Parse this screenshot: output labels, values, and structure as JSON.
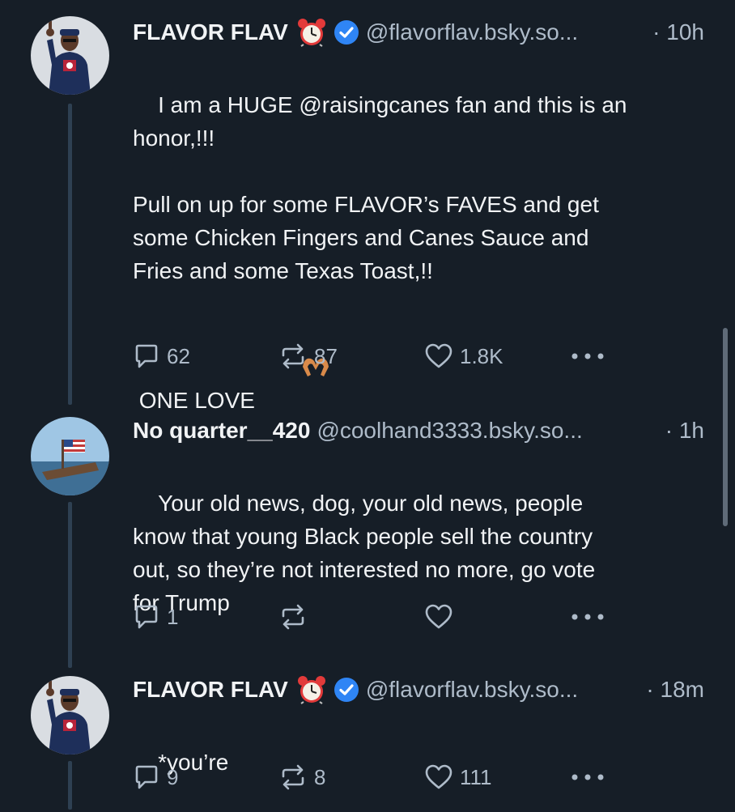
{
  "posts": [
    {
      "display_name": "FLAVOR FLAV",
      "handle": "@flavorflav.bsky.so...",
      "time": "· 10h",
      "text": "I am a HUGE @raisingcanes fan and this is an\nhonor,!!!\n\nPull on up for some FLAVOR’s FAVES and get\nsome Chicken Fingers and Canes Sauce and\nFries and some Texas Toast,!!\n\n ONE LOVE",
      "replies": "62",
      "reposts": "87",
      "likes": "1.8K"
    },
    {
      "display_name": "No quarter__420",
      "handle": "@coolhand3333.bsky.so...",
      "time": "· 1h",
      "text": "Your old news, dog, your old news, people\nknow that young Black people sell the country\nout, so they’re not interested no more, go vote\nfor Trump",
      "replies": "1",
      "reposts": "",
      "likes": ""
    },
    {
      "display_name": "FLAVOR FLAV",
      "handle": "@flavorflav.bsky.so...",
      "time": "· 18m",
      "text": "*you’re",
      "replies": "9",
      "reposts": "8",
      "likes": "111"
    }
  ],
  "colors": {
    "background": "#161e27",
    "text": "#f1f3f5",
    "muted": "#aebbc9",
    "verified": "#2f85f5",
    "thread_line": "#2e4052"
  },
  "icons": [
    "alarm-clock-icon",
    "verified-badge-icon",
    "heart-hands-icon",
    "reply-icon",
    "repost-icon",
    "like-icon",
    "more-icon"
  ]
}
